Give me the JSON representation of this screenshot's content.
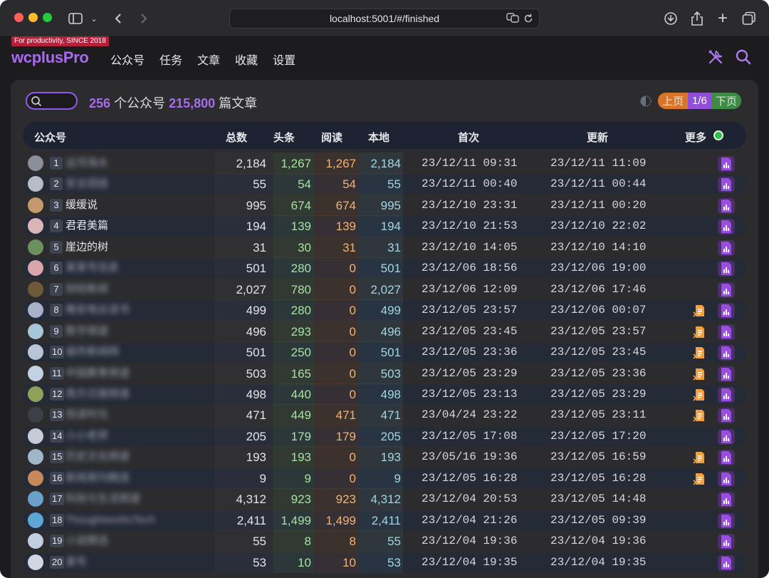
{
  "browser": {
    "url": "localhost:5001/#/finished"
  },
  "app": {
    "slogan": "For productivity, SINCE 2018",
    "brand": "wcplusPro",
    "nav": [
      "公众号",
      "任务",
      "文章",
      "收藏",
      "设置"
    ]
  },
  "summary": {
    "accounts": "256",
    "accounts_unit": "个公众号",
    "articles": "215,800",
    "articles_unit": "篇文章"
  },
  "pager": {
    "prev": "上页",
    "page": "1/6",
    "next": "下页"
  },
  "table": {
    "headers": [
      "公众号",
      "总数",
      "头条",
      "阅读",
      "本地",
      "首次",
      "更新",
      "更多"
    ],
    "rows": [
      {
        "i": "1",
        "name": "运河海水",
        "blur": true,
        "total": "2,184",
        "head": "1,267",
        "read": "1,267",
        "local": "2,184",
        "first": "23/12/11 09:31",
        "update": "23/12/11 11:09",
        "export": false
      },
      {
        "i": "2",
        "name": "安全团组",
        "blur": true,
        "total": "55",
        "head": "54",
        "read": "54",
        "local": "55",
        "first": "23/12/11 00:40",
        "update": "23/12/11 00:44",
        "export": false
      },
      {
        "i": "3",
        "name": "缓缓说",
        "blur": false,
        "total": "995",
        "head": "674",
        "read": "674",
        "local": "995",
        "first": "23/12/10 23:31",
        "update": "23/12/11 00:20",
        "export": false
      },
      {
        "i": "4",
        "name": "君君美篇",
        "blur": false,
        "total": "194",
        "head": "139",
        "read": "139",
        "local": "194",
        "first": "23/12/10 21:53",
        "update": "23/12/10 22:02",
        "export": false
      },
      {
        "i": "5",
        "name": "崖边的树",
        "blur": false,
        "total": "31",
        "head": "30",
        "read": "31",
        "local": "31",
        "first": "23/12/10 14:05",
        "update": "23/12/10 14:10",
        "export": false
      },
      {
        "i": "6",
        "name": "某某号信息",
        "blur": true,
        "total": "501",
        "head": "280",
        "read": "0",
        "local": "501",
        "first": "23/12/06 18:56",
        "update": "23/12/06 19:00",
        "export": false
      },
      {
        "i": "7",
        "name": "财经新闻",
        "blur": true,
        "total": "2,027",
        "head": "780",
        "read": "0",
        "local": "2,027",
        "first": "23/12/06 12:09",
        "update": "23/12/06 17:46",
        "export": false
      },
      {
        "i": "8",
        "name": "晚安电台读书",
        "blur": true,
        "total": "499",
        "head": "280",
        "read": "0",
        "local": "499",
        "first": "23/12/05 23:57",
        "update": "23/12/06 00:07",
        "export": true
      },
      {
        "i": "9",
        "name": "数字频道",
        "blur": true,
        "total": "496",
        "head": "293",
        "read": "0",
        "local": "496",
        "first": "23/12/05 23:45",
        "update": "23/12/05 23:57",
        "export": true
      },
      {
        "i": "10",
        "name": "城市新闻网",
        "blur": true,
        "total": "501",
        "head": "250",
        "read": "0",
        "local": "501",
        "first": "23/12/05 23:36",
        "update": "23/12/05 23:45",
        "export": true
      },
      {
        "i": "11",
        "name": "中国教育频道",
        "blur": true,
        "total": "503",
        "head": "165",
        "read": "0",
        "local": "503",
        "first": "23/12/05 23:29",
        "update": "23/12/05 23:36",
        "export": true
      },
      {
        "i": "12",
        "name": "南方日报频道",
        "blur": true,
        "total": "498",
        "head": "440",
        "read": "0",
        "local": "498",
        "first": "23/12/05 23:13",
        "update": "23/12/05 23:29",
        "export": true
      },
      {
        "i": "13",
        "name": "悦读时光",
        "blur": true,
        "total": "471",
        "head": "449",
        "read": "471",
        "local": "471",
        "first": "23/04/24 23:22",
        "update": "23/12/05 23:11",
        "export": true
      },
      {
        "i": "14",
        "name": "小小老师",
        "blur": true,
        "total": "205",
        "head": "179",
        "read": "179",
        "local": "205",
        "first": "23/12/05 17:08",
        "update": "23/12/05 17:20",
        "export": false
      },
      {
        "i": "15",
        "name": "历史文化频道",
        "blur": true,
        "total": "193",
        "head": "193",
        "read": "0",
        "local": "193",
        "first": "23/05/16 19:36",
        "update": "23/12/05 16:59",
        "export": true
      },
      {
        "i": "16",
        "name": "新闻周刊精选",
        "blur": true,
        "total": "9",
        "head": "9",
        "read": "0",
        "local": "9",
        "first": "23/12/05 16:28",
        "update": "23/12/05 16:28",
        "export": true
      },
      {
        "i": "17",
        "name": "科技与生活频道",
        "blur": true,
        "total": "4,312",
        "head": "923",
        "read": "923",
        "local": "4,312",
        "first": "23/12/04 20:53",
        "update": "23/12/05 14:48",
        "export": false
      },
      {
        "i": "18",
        "name": "ThoughtworksTech",
        "blur": true,
        "total": "2,411",
        "head": "1,499",
        "read": "1,499",
        "local": "2,411",
        "first": "23/12/04 21:26",
        "update": "23/12/05 09:39",
        "export": false
      },
      {
        "i": "19",
        "name": "小说精选",
        "blur": true,
        "total": "55",
        "head": "8",
        "read": "8",
        "local": "55",
        "first": "23/12/04 19:36",
        "update": "23/12/04 19:36",
        "export": false
      },
      {
        "i": "20",
        "name": "某号",
        "blur": true,
        "total": "53",
        "head": "10",
        "read": "10",
        "local": "53",
        "first": "23/12/04 19:35",
        "update": "23/12/04 19:35",
        "export": false
      }
    ]
  },
  "colors": {
    "accent": "#a86bf0",
    "head_col": "#a5e3a0",
    "read_col": "#f0b37a",
    "local_col": "#9fd8e4"
  }
}
